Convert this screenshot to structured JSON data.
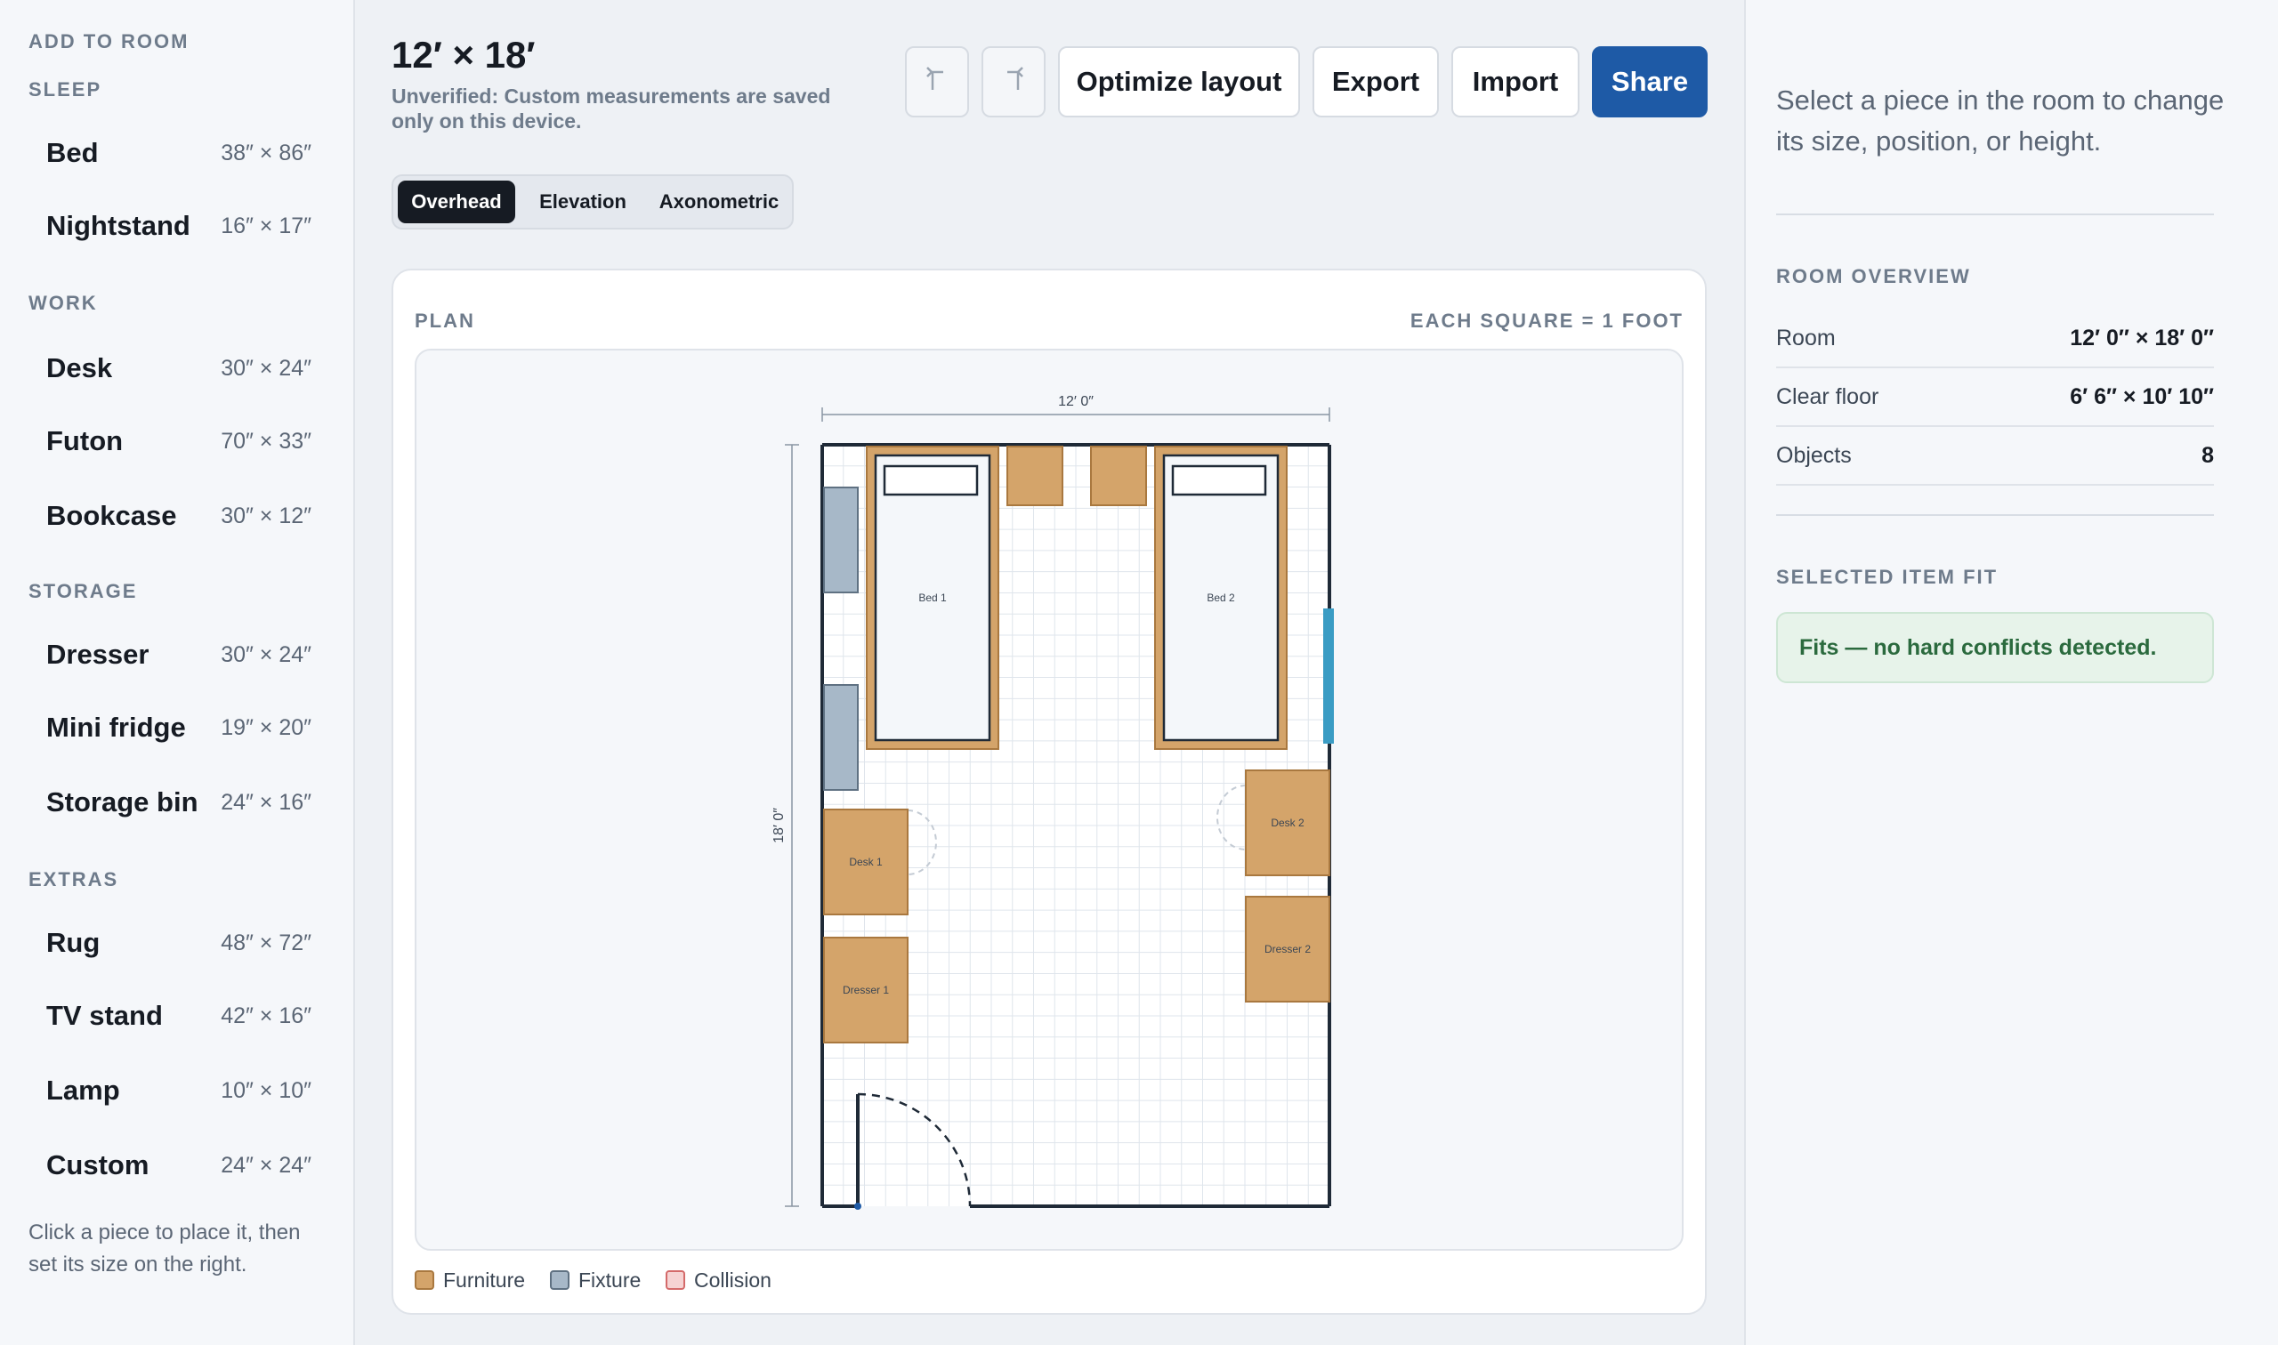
{
  "sidebar": {
    "heading": "ADD TO ROOM",
    "sections": [
      {
        "title": "SLEEP",
        "items": [
          {
            "name": "Bed",
            "dims": "38″ × 86″"
          },
          {
            "name": "Nightstand",
            "dims": "16″ × 17″"
          }
        ]
      },
      {
        "title": "WORK",
        "items": [
          {
            "name": "Desk",
            "dims": "30″ × 24″"
          },
          {
            "name": "Futon",
            "dims": "70″ × 33″"
          },
          {
            "name": "Bookcase",
            "dims": "30″ × 12″"
          }
        ]
      },
      {
        "title": "STORAGE",
        "items": [
          {
            "name": "Dresser",
            "dims": "30″ × 24″"
          },
          {
            "name": "Mini fridge",
            "dims": "19″ × 20″"
          },
          {
            "name": "Storage bin",
            "dims": "24″ × 16″"
          }
        ]
      },
      {
        "title": "EXTRAS",
        "items": [
          {
            "name": "Rug",
            "dims": "48″ × 72″"
          },
          {
            "name": "TV stand",
            "dims": "42″ × 16″"
          },
          {
            "name": "Lamp",
            "dims": "10″ × 10″"
          },
          {
            "name": "Custom",
            "dims": "24″ × 24″"
          }
        ]
      }
    ],
    "help": "Click a piece to place it, then set its size on the right."
  },
  "header": {
    "title": "12′ × 18′",
    "subtitle": "Unverified: Custom measurements are saved only on this device.",
    "undo_icon": "undo-icon",
    "redo_icon": "redo-icon",
    "buttons": {
      "optimize": "Optimize layout",
      "export": "Export",
      "import": "Import",
      "share": "Share"
    }
  },
  "tabs": [
    {
      "label": "Overhead",
      "active": true
    },
    {
      "label": "Elevation",
      "active": false
    },
    {
      "label": "Axonometric",
      "active": false
    }
  ],
  "plan": {
    "label": "PLAN",
    "scale_note": "EACH SQUARE = 1 FOOT",
    "room_width_label": "12′ 0″",
    "room_length_label": "18′ 0″",
    "room_ft": {
      "width": 12,
      "length": 18
    },
    "furniture": [
      {
        "label": "Bed 1",
        "kind": "bed"
      },
      {
        "label": "Bed 2",
        "kind": "bed"
      },
      {
        "label": "Desk 1",
        "kind": "desk"
      },
      {
        "label": "Desk 2",
        "kind": "desk"
      },
      {
        "label": "Dresser 1",
        "kind": "dresser"
      },
      {
        "label": "Dresser 2",
        "kind": "dresser"
      }
    ],
    "legend": [
      {
        "label": "Furniture",
        "fill": "#d4a46a",
        "stroke": "#a9783f"
      },
      {
        "label": "Fixture",
        "fill": "#a7b8c8",
        "stroke": "#5f7182"
      },
      {
        "label": "Collision",
        "fill": "#f6d3d3",
        "stroke": "#d46a6a"
      }
    ]
  },
  "right_panel": {
    "help": "Select a piece in the room to change its size, position, or height.",
    "overview_title": "ROOM OVERVIEW",
    "overview": [
      {
        "key": "Room",
        "value": "12′ 0″ × 18′ 0″"
      },
      {
        "key": "Clear floor",
        "value": "6′ 6″ × 10′ 10″"
      },
      {
        "key": "Objects",
        "value": "8"
      }
    ],
    "fit_title": "SELECTED ITEM FIT",
    "fit_message": "Fits — no hard conflicts detected."
  },
  "colors": {
    "accent": "#1e5aa6",
    "furniture": "#d4a46a",
    "fixture": "#a7b8c8",
    "window": "#3a9cc4",
    "wall": "#1f2a37"
  }
}
